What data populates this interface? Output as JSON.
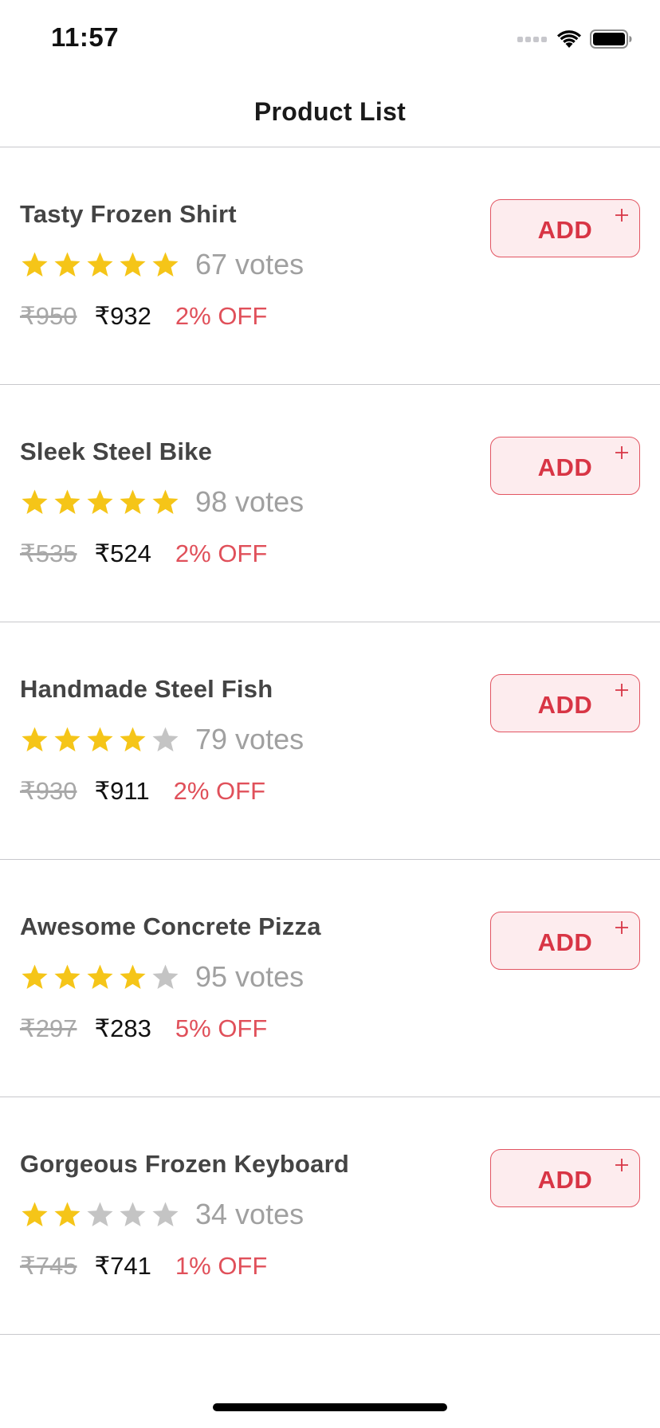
{
  "status_bar": {
    "time": "11:57",
    "icons": [
      "cellular-signal-icon",
      "wifi-icon",
      "battery-icon"
    ]
  },
  "nav": {
    "title": "Product List"
  },
  "colors": {
    "star_filled": "#F5C518",
    "star_empty": "#C4C4C4",
    "accent": "#D83545",
    "discount": "#E0505A"
  },
  "products": [
    {
      "name": "Tasty Frozen Shirt",
      "rating": 5,
      "max_rating": 5,
      "votes": "67 votes",
      "mrp": "₹950",
      "price": "₹932",
      "discount": "2% OFF",
      "add_label": "ADD"
    },
    {
      "name": "Sleek Steel Bike",
      "rating": 5,
      "max_rating": 5,
      "votes": "98 votes",
      "mrp": "₹535",
      "price": "₹524",
      "discount": "2% OFF",
      "add_label": "ADD"
    },
    {
      "name": "Handmade Steel Fish",
      "rating": 4,
      "max_rating": 5,
      "votes": "79 votes",
      "mrp": "₹930",
      "price": "₹911",
      "discount": "2% OFF",
      "add_label": "ADD"
    },
    {
      "name": "Awesome Concrete Pizza",
      "rating": 4,
      "max_rating": 5,
      "votes": "95 votes",
      "mrp": "₹297",
      "price": "₹283",
      "discount": "5% OFF",
      "add_label": "ADD"
    },
    {
      "name": "Gorgeous Frozen Keyboard",
      "rating": 2,
      "max_rating": 5,
      "votes": "34 votes",
      "mrp": "₹745",
      "price": "₹741",
      "discount": "1% OFF",
      "add_label": "ADD"
    }
  ]
}
